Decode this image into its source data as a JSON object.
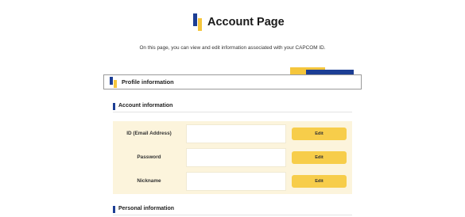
{
  "header": {
    "title": "Account Page",
    "logo_icon": "capcom-logo-mark-icon"
  },
  "intro": {
    "text": "On this page, you can view and edit information associated with your CAPCOM ID."
  },
  "profile": {
    "label": "Profile information"
  },
  "account_section": {
    "heading": "Account information",
    "rows": [
      {
        "label": "ID (Email Address)",
        "value": "",
        "button": "Edit"
      },
      {
        "label": "Password",
        "value": "",
        "button": "Edit"
      },
      {
        "label": "Nickname",
        "value": "",
        "button": "Edit"
      }
    ]
  },
  "personal_section": {
    "heading": "Personal information"
  },
  "colors": {
    "brand_blue": "#1c3e94",
    "brand_yellow": "#f5c63c",
    "table_bg": "#fcf4dc",
    "button_bg": "#f7cd4a"
  }
}
